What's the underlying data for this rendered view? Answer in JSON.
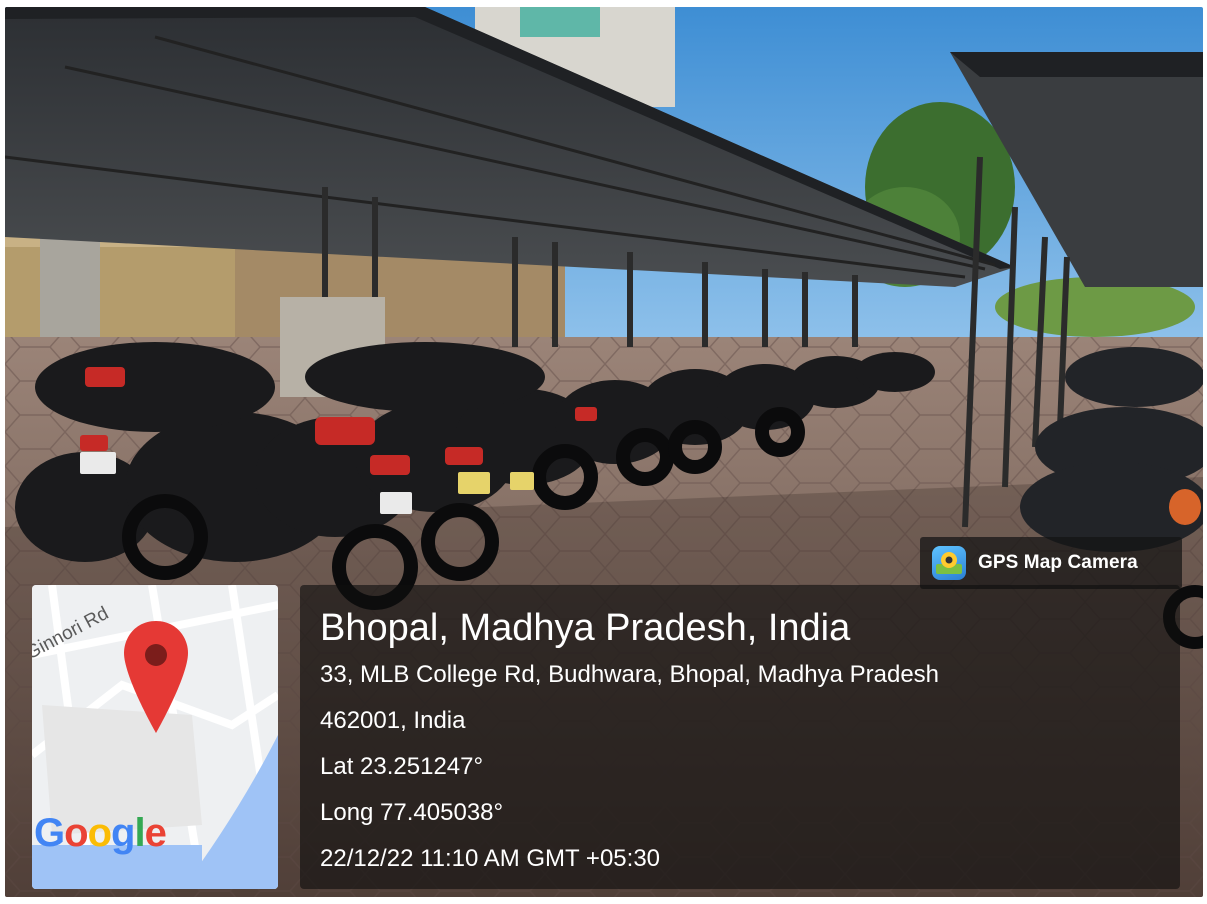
{
  "badge": {
    "label": "GPS Map Camera",
    "icon": "map-pin-camera-icon"
  },
  "map": {
    "road_label": "Ginnori Rd",
    "provider_logo": {
      "letters": [
        "G",
        "o",
        "o",
        "g",
        "l",
        "e"
      ],
      "colors": [
        "#4285F4",
        "#EA4335",
        "#FBBC05",
        "#4285F4",
        "#34A853",
        "#EA4335"
      ]
    },
    "pin_color": "#E53935",
    "water_color": "#9FC3F6"
  },
  "location": {
    "title": "Bhopal, Madhya Pradesh, India",
    "address_line1": "33, MLB College Rd, Budhwara, Bhopal, Madhya Pradesh",
    "address_line2": "462001, India",
    "latitude": "Lat 23.251247°",
    "longitude": "Long 77.405038°",
    "timestamp": "22/12/22 11:10 AM GMT +05:30"
  },
  "scene": {
    "description_icon": "parking-shed-photo",
    "sky_color": "#4f98d6",
    "roof_color": "#3a3d40",
    "pavement_color": "#8a6f62"
  }
}
